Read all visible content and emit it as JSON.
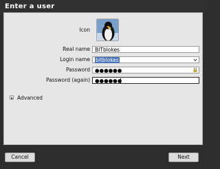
{
  "window": {
    "title": "Enter a user"
  },
  "form": {
    "icon_label": "Icon",
    "real_name_label": "Real name",
    "real_name_value": "BITblokes",
    "login_name_label": "Login name",
    "login_name_value": "bitblokes",
    "password_label": "Password",
    "password_value": "●●●●●●",
    "password_again_label": "Password (again)",
    "password_again_value": "●●●●●●"
  },
  "advanced": {
    "label": "Advanced"
  },
  "buttons": {
    "cancel": "Cancel",
    "next": "Next"
  },
  "icons": {
    "avatar": "penguin-avatar-icon",
    "combo": "chevron-down-icon",
    "lock": "lock-icon",
    "expander": "triangle-right-icon"
  },
  "colors": {
    "selection": "#4a72b8",
    "titlebar": "#303030",
    "panel": "#e6e6e6"
  }
}
